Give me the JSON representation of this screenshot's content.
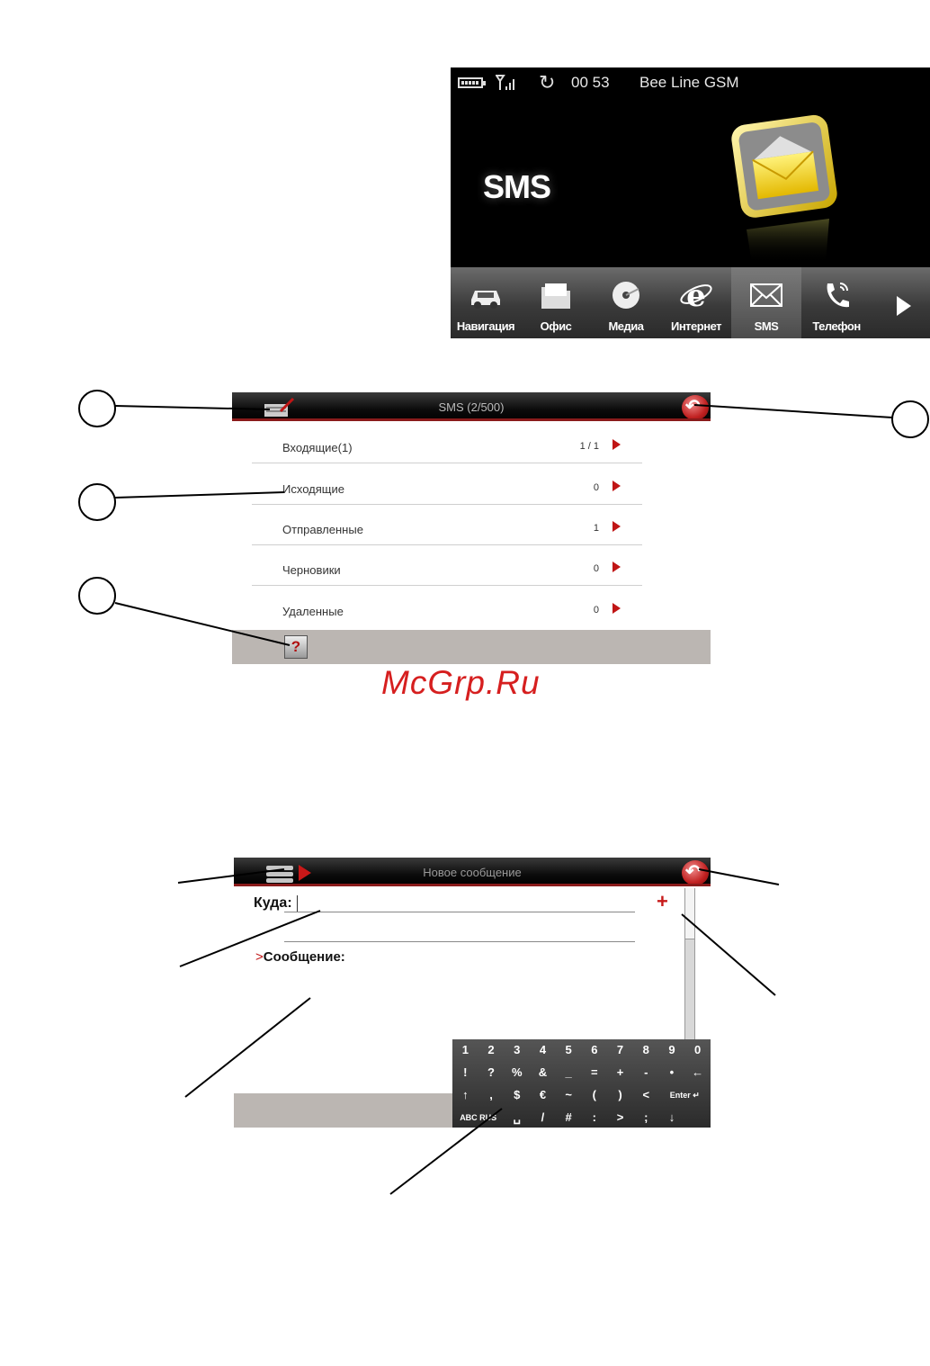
{
  "home_screen": {
    "status": {
      "time": "00 53",
      "carrier": "Bee Line GSM"
    },
    "big_label": "SMS",
    "dock": [
      {
        "label": "Навигация",
        "icon": "car-icon"
      },
      {
        "label": "Офис",
        "icon": "folder-icon"
      },
      {
        "label": "Медиа",
        "icon": "disc-icon"
      },
      {
        "label": "Интернет",
        "icon": "ie-icon"
      },
      {
        "label": "SMS",
        "icon": "envelope-icon",
        "active": true
      },
      {
        "label": "Телефон",
        "icon": "phone-icon"
      }
    ]
  },
  "sms_screen": {
    "title": "SMS (2/500)",
    "folders": [
      {
        "name": "Входящие(1)",
        "count": "1 / 1"
      },
      {
        "name": "Исходящие",
        "count": "0"
      },
      {
        "name": "Отправленные",
        "count": "1"
      },
      {
        "name": "Черновики",
        "count": "0"
      },
      {
        "name": "Удаленные",
        "count": "0"
      }
    ],
    "help_glyph": "?"
  },
  "watermark": "McGrp.Ru",
  "new_message_screen": {
    "title": "Новое сообщение",
    "to_label": "Куда:",
    "add_glyph": "+",
    "message_marker": ">",
    "message_label": "Сообщение:",
    "keyboard": {
      "rows": [
        [
          "1",
          "2",
          "3",
          "4",
          "5",
          "6",
          "7",
          "8",
          "9",
          "0"
        ],
        [
          "!",
          "?",
          "%",
          "&",
          "_",
          "=",
          "+",
          "-",
          "•",
          "←"
        ],
        [
          "↑",
          ",",
          "$",
          "€",
          "~",
          "(",
          ")",
          "<",
          "Enter ↵"
        ],
        [
          "ABC RUS",
          "␣",
          "/",
          "#",
          ":",
          ">",
          ";",
          "↓"
        ]
      ]
    }
  },
  "colors": {
    "accent_red": "#c01515",
    "titlebar": "#000000",
    "footer": "#bbb6b2"
  }
}
